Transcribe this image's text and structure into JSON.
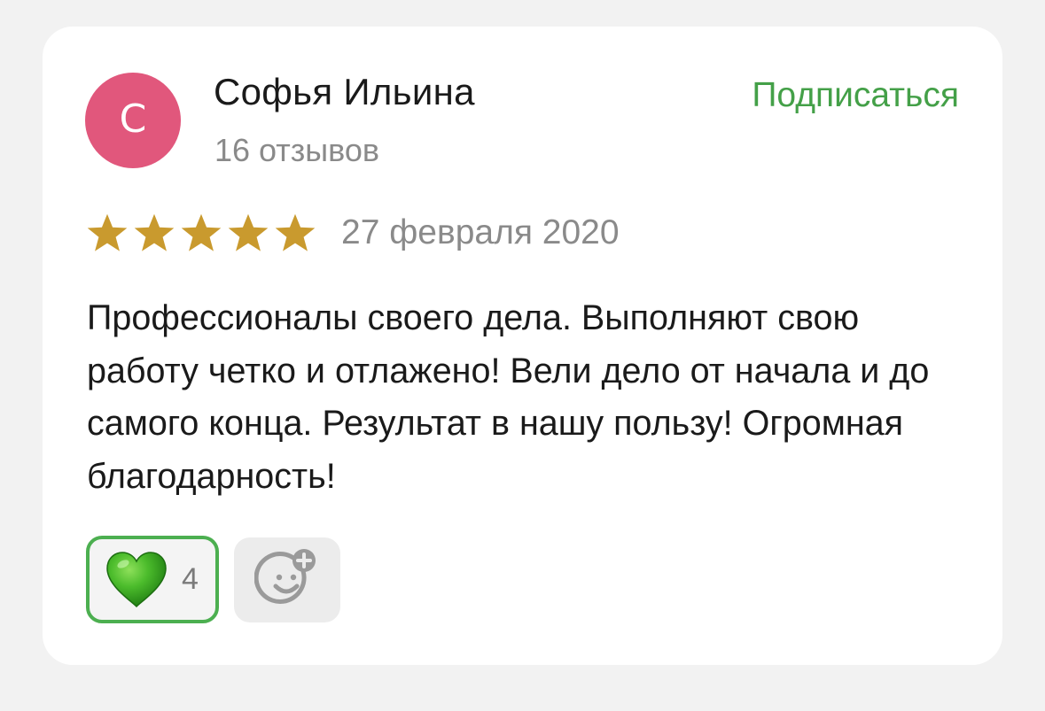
{
  "author": {
    "initial": "С",
    "name": "Софья Ильина",
    "reviews_count": "16 отзывов",
    "avatar_color": "#e1577c"
  },
  "subscribe": {
    "label": "Подписаться",
    "color": "#44a048"
  },
  "review": {
    "rating": 5,
    "rating_max": 5,
    "star_color": "#c99a2e",
    "date": "27 февраля 2020",
    "text": "Профессионалы своего дела. Выполняют свою работу четко и отлажено! Вели дело от начала и до самого конца. Результат в нашу пользу! Огромная благодарность!"
  },
  "reactions": {
    "like": {
      "icon": "green-heart-icon",
      "count": "4"
    },
    "add": {
      "icon": "add-reaction-smiley-icon"
    }
  }
}
